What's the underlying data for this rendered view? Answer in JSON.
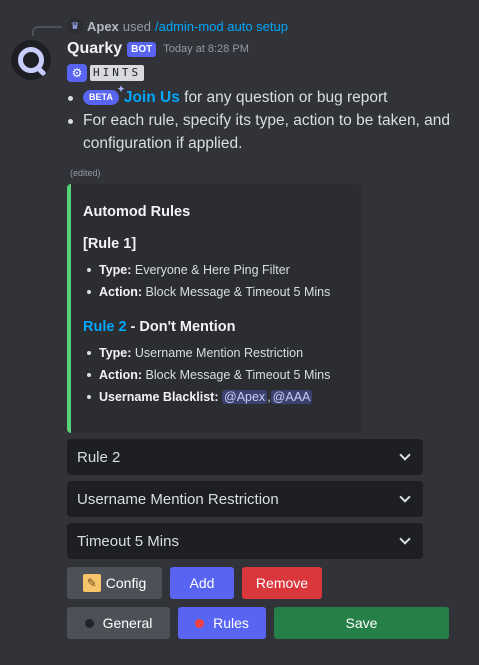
{
  "reply": {
    "user": "Apex",
    "verb": "used",
    "command": "/admin-mod auto setup"
  },
  "message": {
    "username": "Quarky",
    "bot_badge": "BOT",
    "timestamp": "Today at 8:28 PM",
    "hints_label": "HINTS",
    "bullets": [
      {
        "badge": "BETA",
        "link": "Join Us",
        "text": " for any question or bug report"
      },
      {
        "text": "For each rule, specify its type, action to be taken, and configuration if applied."
      }
    ],
    "edited": "(edited)"
  },
  "embed": {
    "title": "Automod Rules",
    "accent_color": "#57d275",
    "rules": [
      {
        "title": "[Rule 1]",
        "items": [
          {
            "label": "Type:",
            "value": " Everyone & Here Ping Filter"
          },
          {
            "label": "Action:",
            "value": " Block Message  & Timeout 5 Mins"
          }
        ]
      },
      {
        "title_link": "Rule 2",
        "title_rest": " - Don't Mention",
        "items": [
          {
            "label": "Type:",
            "value": " Username Mention Restriction"
          },
          {
            "label": "Action:",
            "value": " Block Message  & Timeout 5 Mins"
          }
        ],
        "blacklist_label": "Username Blacklist:",
        "blacklist": [
          "@Apex",
          "@AAA"
        ],
        "blacklist_sep": ","
      }
    ]
  },
  "selects": [
    {
      "value": "Rule 2"
    },
    {
      "value": "Username Mention Restriction"
    },
    {
      "value": "Timeout 5 Mins"
    }
  ],
  "buttons": {
    "config": "Config",
    "add": "Add",
    "remove": "Remove",
    "general": "General",
    "rules": "Rules",
    "save": "Save"
  },
  "colors": {
    "background": "#313338",
    "blurple": "#5865f2",
    "danger": "#da373c",
    "success": "#248046",
    "secondary": "#4e5058",
    "link": "#00a8fc"
  },
  "icons": {
    "config": "memo-icon",
    "general_dot": "black-circle-icon",
    "rules_dot": "red-circle-icon",
    "hints": "robot-icon"
  }
}
